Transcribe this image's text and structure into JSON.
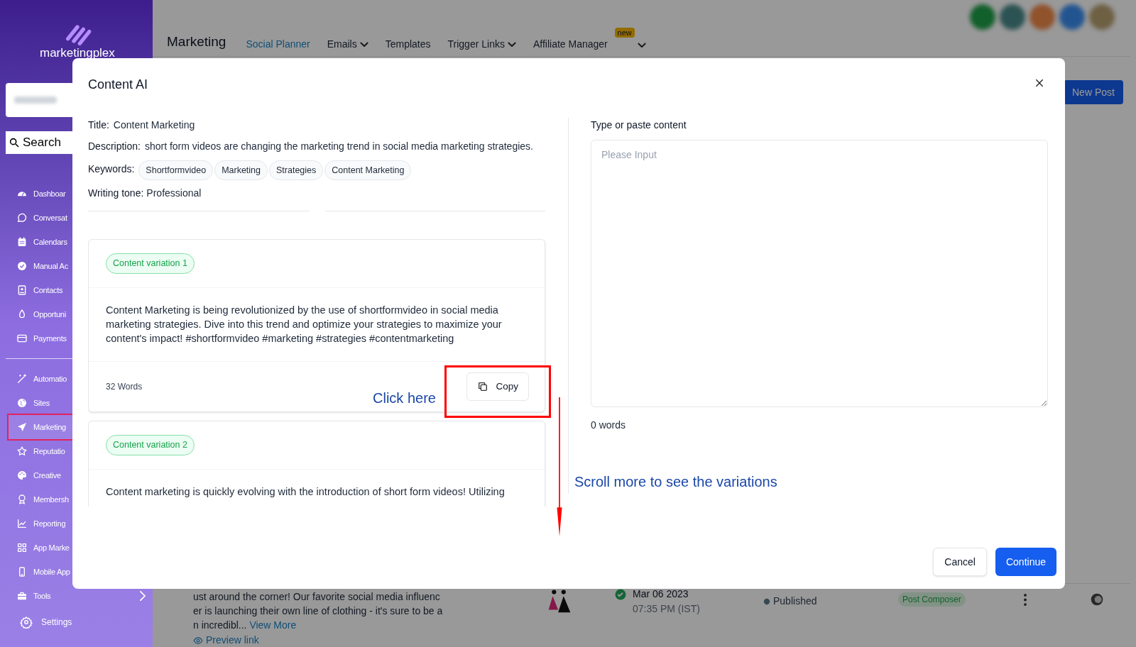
{
  "sidebar": {
    "logo": "marketingplex",
    "search_placeholder": "Search",
    "groups": [
      [
        {
          "label": "Dashboar",
          "selected": false
        },
        {
          "label": "Conversat",
          "selected": false
        },
        {
          "label": "Calendars",
          "selected": false
        },
        {
          "label": "Manual Ac",
          "selected": false
        },
        {
          "label": "Contacts",
          "selected": false
        },
        {
          "label": "Opportuni",
          "selected": false
        },
        {
          "label": "Payments",
          "selected": false
        }
      ],
      [
        {
          "label": "Automatio",
          "selected": false
        },
        {
          "label": "Sites",
          "selected": false
        },
        {
          "label": "Marketing",
          "selected": true
        },
        {
          "label": "Reputatio",
          "selected": false
        },
        {
          "label": "Creative",
          "selected": false
        },
        {
          "label": "Membersh",
          "selected": false
        },
        {
          "label": "Reporting",
          "selected": false
        },
        {
          "label": "App Marke",
          "selected": false
        },
        {
          "label": "Mobile App",
          "selected": false
        },
        {
          "label": "Tools",
          "selected": false,
          "expandable": true
        }
      ]
    ],
    "settings": "Settings"
  },
  "topnav": {
    "title": "Marketing",
    "tabs": [
      {
        "label": "Social Planner",
        "selected": true
      },
      {
        "label": "Emails",
        "selected": false,
        "dropdown": true
      },
      {
        "label": "Templates",
        "selected": false
      },
      {
        "label": "Trigger Links",
        "selected": false,
        "dropdown": true
      },
      {
        "label": "Affiliate Manager",
        "selected": false,
        "badge": "new"
      }
    ],
    "more_menu": true
  },
  "new_post_button": "New Post",
  "post": {
    "text_lines": [
      "ust around the corner! Our favorite social media influenc",
      "er is launching their own line of clothing - it's sure to be a",
      "n incredibl..."
    ],
    "view_more": "View More",
    "preview_link": "Preview link",
    "date": "Mar 06 2023",
    "time": "07:35 PM (IST)",
    "status": "Published",
    "source": "Post Composer"
  },
  "modal": {
    "title": "Content AI",
    "fields": [
      {
        "label": "Title:",
        "value": "Content Marketing"
      },
      {
        "label": "Description:",
        "value": "short form videos are changing the marketing trend in social media marketing strategies."
      }
    ],
    "keywords_label": "Keywords:",
    "keywords": [
      "Shortformvideo",
      "Marketing",
      "Strategies",
      "Content Marketing"
    ],
    "tone_label": "Writing tone:",
    "tone": "Professional",
    "variations": [
      {
        "badge": "Content variation 1",
        "text": "Content Marketing is being revolutionized by the use of shortformvideo in social media marketing strategies. Dive into this trend and optimize your strategies to maximize your content's impact! #shortformvideo #marketing #strategies #contentmarketing",
        "word_count": "32 Words",
        "copy": "Copy"
      },
      {
        "badge": "Content variation 2",
        "text": "Content marketing is quickly evolving with the introduction of short form videos! Utilizing"
      }
    ],
    "editor": {
      "label": "Type or paste content",
      "placeholder": "Please Input",
      "word_count": "0 words"
    },
    "buttons": [
      {
        "label": "Cancel",
        "kind": "secondary"
      },
      {
        "label": "Continue",
        "kind": "primary"
      }
    ]
  },
  "annotations": {
    "click_hint": "Click here",
    "scroll_hint": "Scroll more to see the variations"
  }
}
